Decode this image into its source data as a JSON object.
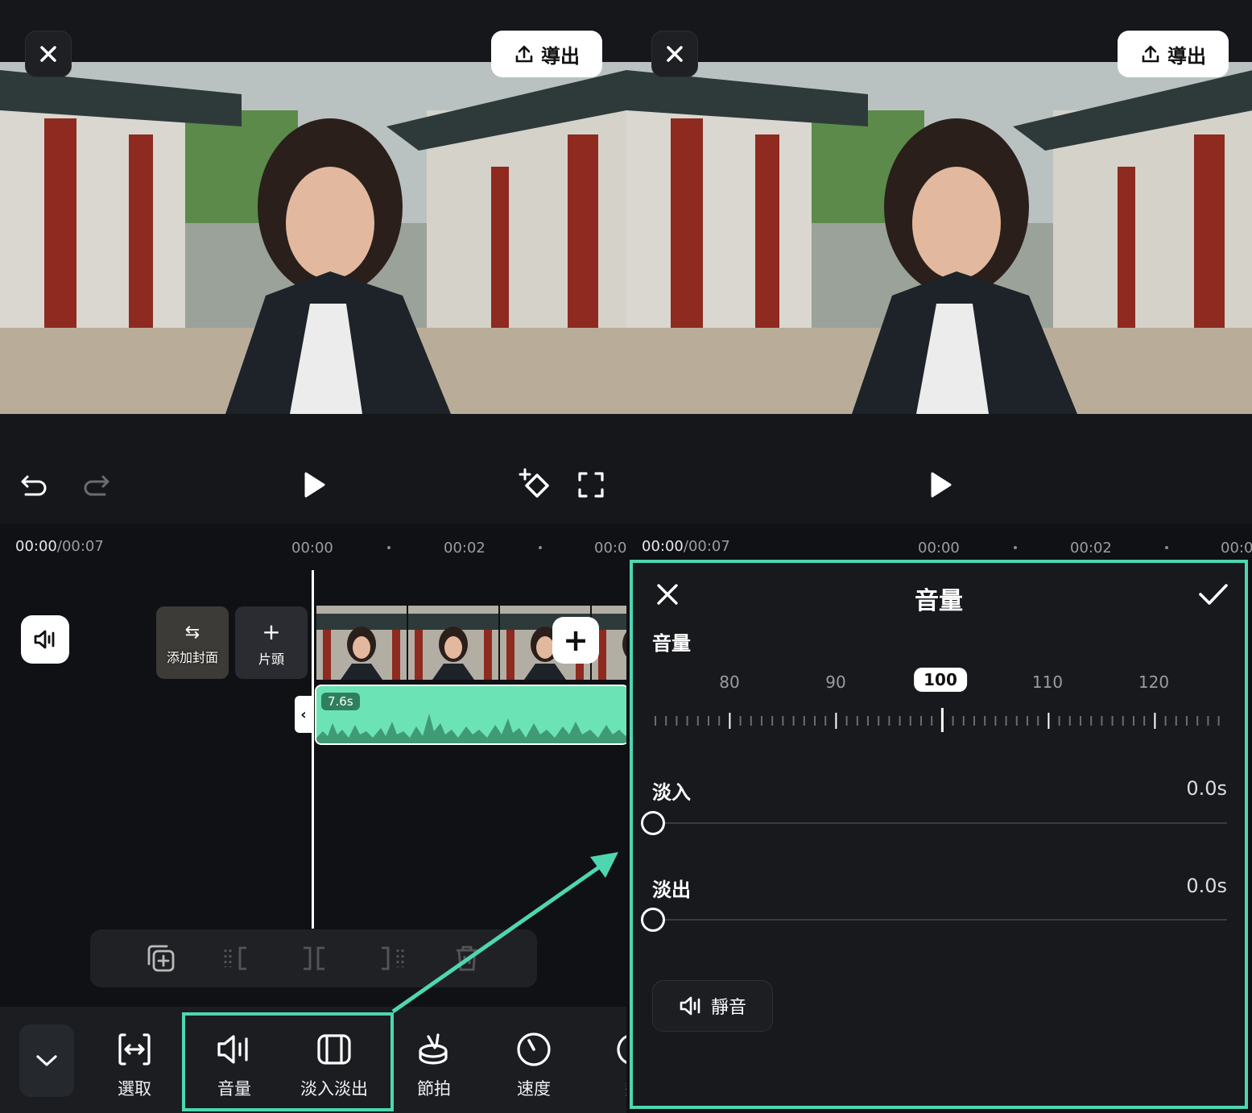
{
  "left": {
    "export_label": "導出",
    "timecode_current": "00:00",
    "timecode_total": "/00:07",
    "ruler": [
      "00:00",
      "00:02",
      "00:0"
    ],
    "cover_label": "添加封面",
    "head_label": "片頭",
    "audio_clip_duration": "7.6s",
    "tools": [
      {
        "label": "選取",
        "icon": "select-icon"
      },
      {
        "label": "音量",
        "icon": "volume-icon"
      },
      {
        "label": "淡入淡出",
        "icon": "fade-icon"
      },
      {
        "label": "節拍",
        "icon": "beat-icon"
      },
      {
        "label": "速度",
        "icon": "speed-icon"
      },
      {
        "label": "變",
        "icon": "change-icon"
      }
    ]
  },
  "right": {
    "export_label": "導出",
    "timecode_current": "00:00",
    "timecode_total": "/00:07",
    "ruler": [
      "00:00",
      "00:02",
      "00:0"
    ],
    "panel": {
      "title": "音量",
      "volume_label": "音量",
      "scale": [
        "80",
        "90",
        "100",
        "110",
        "120"
      ],
      "current_volume": "100",
      "fade_in_label": "淡入",
      "fade_in_value": "0.0s",
      "fade_out_label": "淡出",
      "fade_out_value": "0.0s",
      "mute_label": "靜音"
    }
  },
  "colors": {
    "accent": "#4fd6b1",
    "audio_clip": "#6ce3b4",
    "background": "#17191d"
  }
}
